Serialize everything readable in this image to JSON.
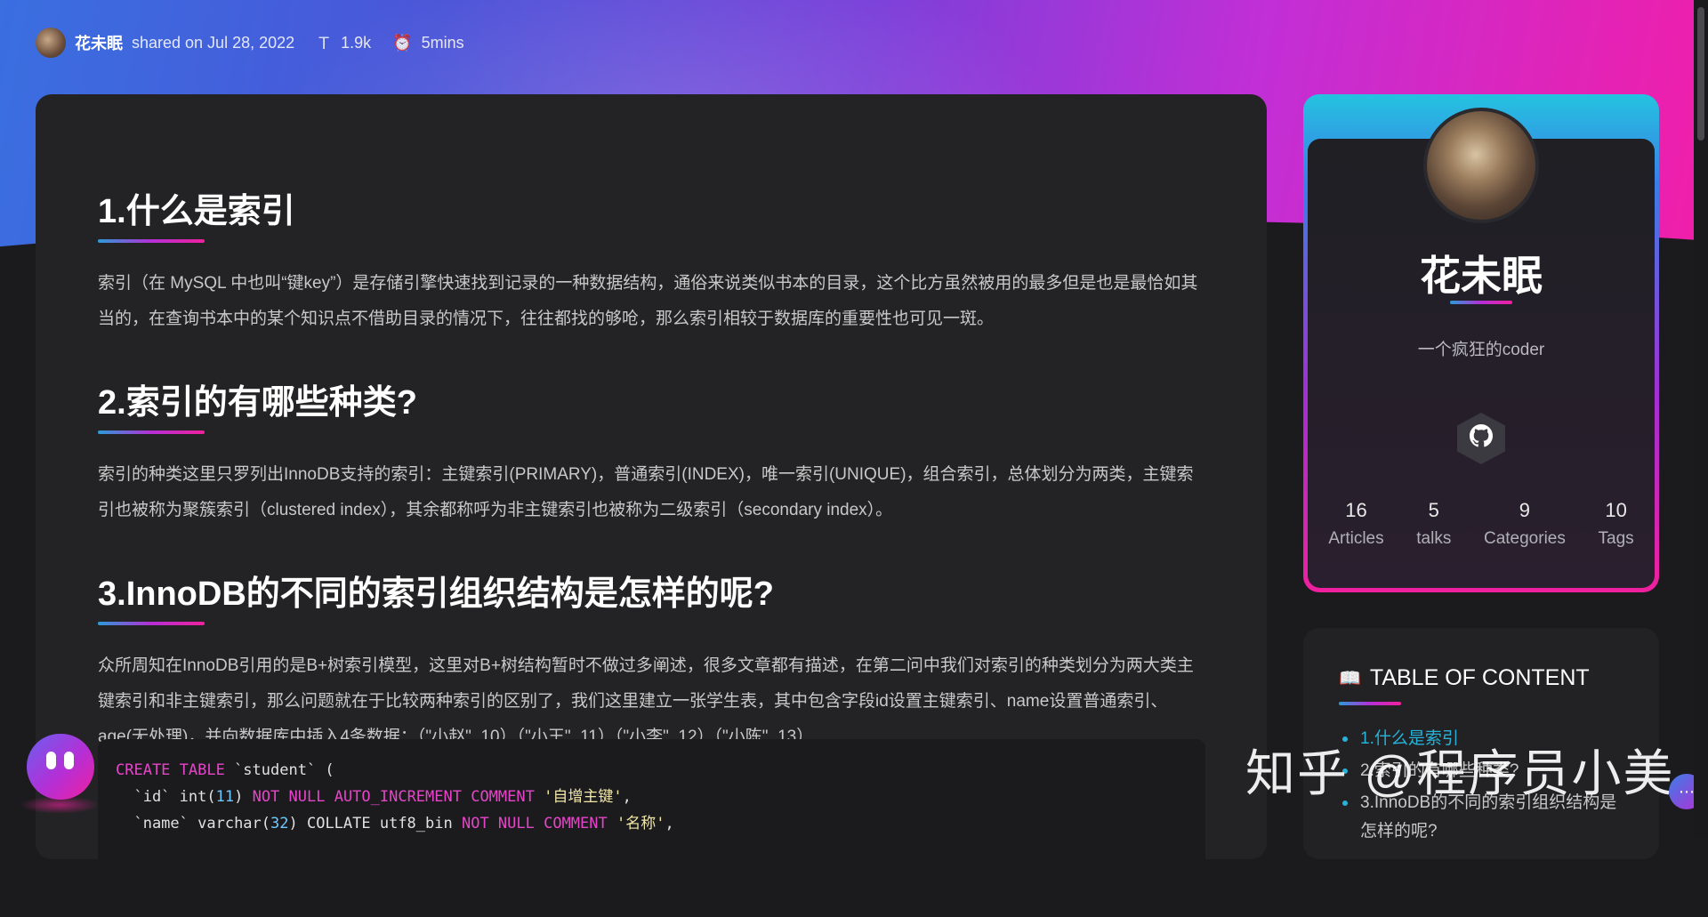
{
  "meta": {
    "author": "花未眠",
    "shared_on": "shared on Jul 28, 2022",
    "word_count": "1.9k",
    "read_time": "5mins"
  },
  "article": {
    "sections": [
      {
        "heading": "1.什么是索引",
        "body": "索引（在 MySQL 中也叫“键key”）是存储引擎快速找到记录的一种数据结构，通俗来说类似书本的目录，这个比方虽然被用的最多但是也是最恰如其当的，在查询书本中的某个知识点不借助目录的情况下，往往都找的够呛，那么索引相较于数据库的重要性也可见一斑。"
      },
      {
        "heading": "2.索引的有哪些种类?",
        "body": "索引的种类这里只罗列出InnoDB支持的索引：主键索引(PRIMARY)，普通索引(INDEX)，唯一索引(UNIQUE)，组合索引，总体划分为两类，主键索引也被称为聚簇索引（clustered index），其余都称呼为非主键索引也被称为二级索引（secondary index）。"
      },
      {
        "heading": "3.InnoDB的不同的索引组织结构是怎样的呢?",
        "body": "众所周知在InnoDB引用的是B+树索引模型，这里对B+树结构暂时不做过多阐述，很多文章都有描述，在第二问中我们对索引的种类划分为两大类主键索引和非主键索引，那么问题就在于比较两种索引的区别了，我们这里建立一张学生表，其中包含字段id设置主键索引、name设置普通索引、age(无处理)，并向数据库中插入4条数据：（\"小赵\", 10）（\"小王\", 11）（\"小李\", 12）（\"小陈\", 13）"
      }
    ],
    "code_lines": [
      {
        "kw1": "CREATE TABLE",
        "rest": " `student` ("
      },
      {
        "name": "  `id`",
        "type": " int(",
        "num": "11",
        "after": ") ",
        "kw": "NOT NULL AUTO_INCREMENT COMMENT",
        "str": " '自增主键'",
        "tail": ","
      },
      {
        "name": "  `name`",
        "type": " varchar(",
        "num": "32",
        "after": ") COLLATE utf8_bin ",
        "kw": "NOT NULL COMMENT",
        "str": " '名称'",
        "tail": ","
      }
    ]
  },
  "profile": {
    "name": "花未眠",
    "bio": "一个疯狂的coder",
    "github_icon": "github-icon",
    "stats": [
      {
        "value": "16",
        "label": "Articles"
      },
      {
        "value": "5",
        "label": "talks"
      },
      {
        "value": "9",
        "label": "Categories"
      },
      {
        "value": "10",
        "label": "Tags"
      }
    ]
  },
  "toc": {
    "title": "TABLE OF CONTENT",
    "items": [
      {
        "label": "1.什么是索引"
      },
      {
        "label": "2.索引的有哪些种类?"
      },
      {
        "label": "3.InnoDB的不同的索引组织结构是怎样的呢?"
      }
    ]
  },
  "watermark": "知乎 @程序员小美",
  "colors": {
    "accent_cyan": "#27b3d9",
    "accent_pink": "#f0209e",
    "accent_purple": "#b52fd6"
  }
}
